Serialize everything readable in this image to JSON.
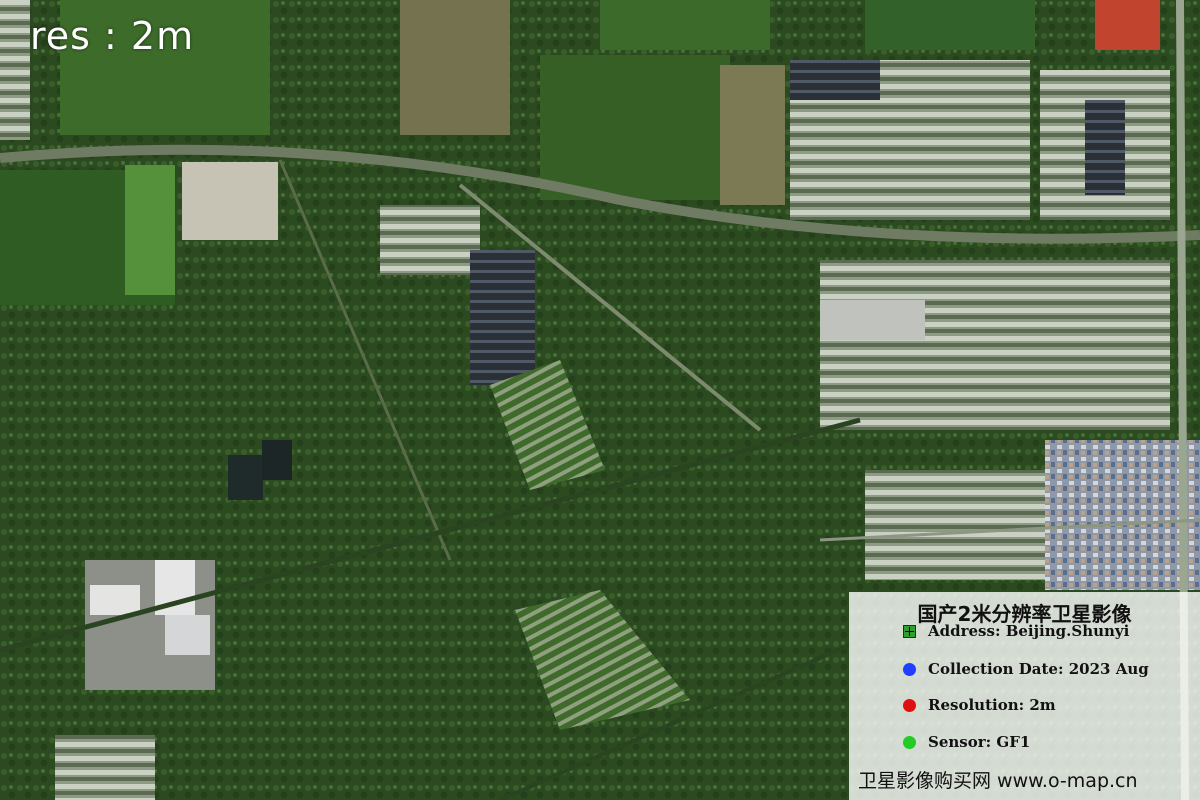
{
  "overlay": {
    "resolution_label": "res : 2m"
  },
  "legend": {
    "title": "国产2米分辨率卫星影像",
    "items": [
      {
        "marker": "green-square-plus",
        "color": "#2fa02f",
        "label": "Address: Beijing.Shunyi"
      },
      {
        "marker": "blue-dot",
        "color": "#1f3fff",
        "label": "Collection Date: 2023 Aug"
      },
      {
        "marker": "red-dot",
        "color": "#e01010",
        "label": "Resolution: 2m"
      },
      {
        "marker": "green-dot",
        "color": "#22cc22",
        "label": "Sensor: GF1"
      }
    ]
  },
  "footer": {
    "text": "卫星影像购买网 www.o-map.cn"
  },
  "colors": {
    "vegetation_dark": "#2f4d22",
    "vegetation_mid": "#3f6a2c",
    "field_light": "#5c8c3a",
    "road": "#7d8a70",
    "greenhouse": "#a9b0a4",
    "building_red": "#c0442e",
    "village": "#b7b9c2"
  }
}
